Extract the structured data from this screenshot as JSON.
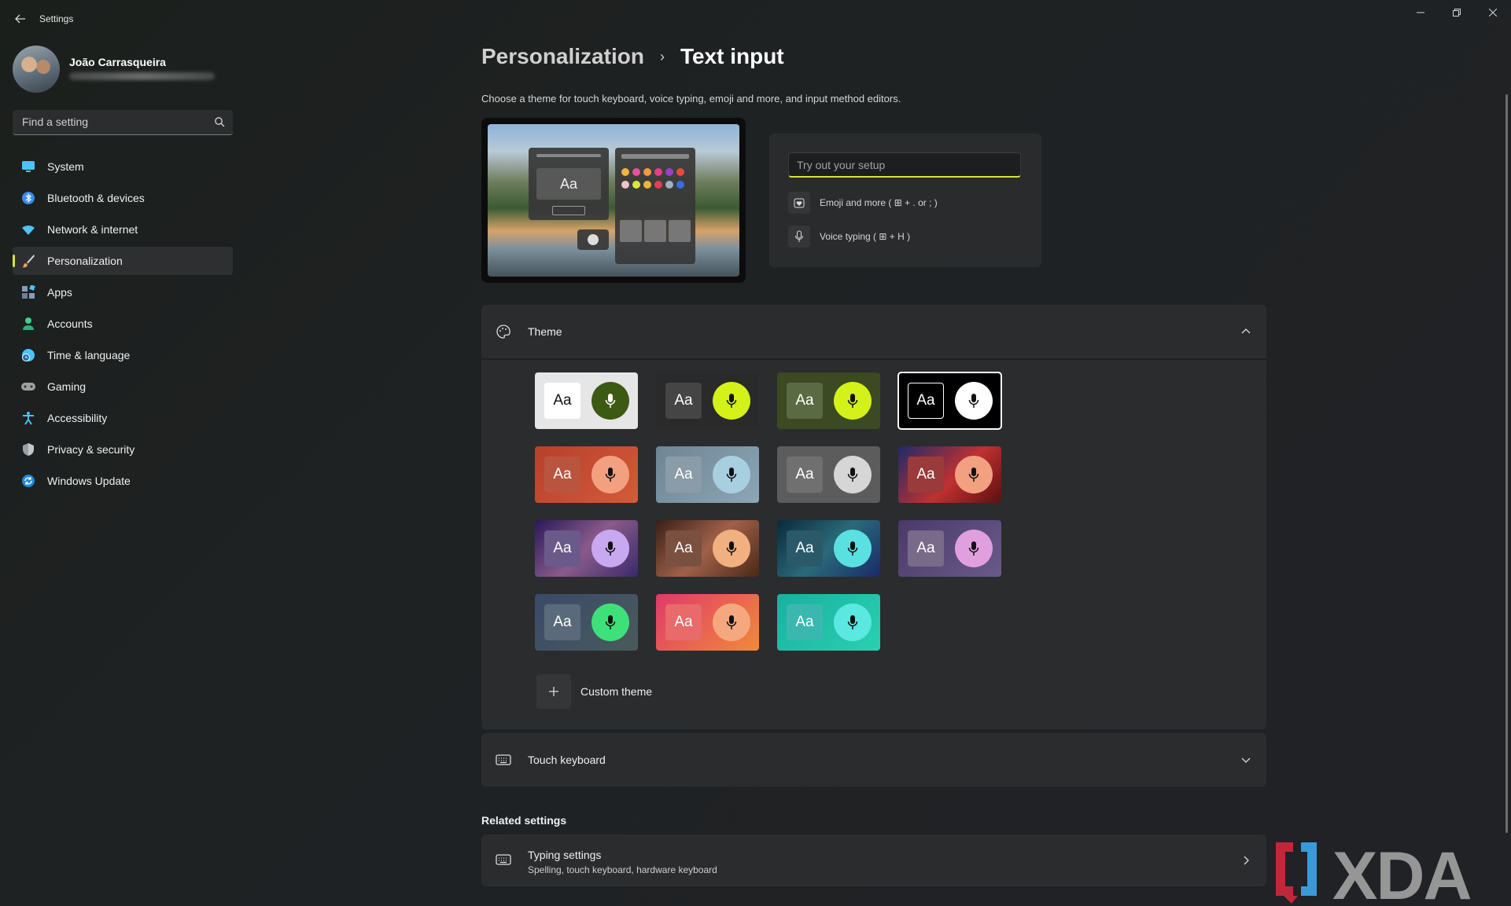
{
  "window": {
    "title": "Settings"
  },
  "user": {
    "name": "João Carrasqueira"
  },
  "search": {
    "placeholder": "Find a setting"
  },
  "sidebar": {
    "items": [
      {
        "label": "System",
        "icon": "monitor-icon",
        "color": "#4cc2ff"
      },
      {
        "label": "Bluetooth & devices",
        "icon": "bluetooth-icon",
        "color": "#3b8eea"
      },
      {
        "label": "Network & internet",
        "icon": "wifi-icon",
        "color": "#4cc2ff"
      },
      {
        "label": "Personalization",
        "icon": "brush-icon",
        "color": "#e8a060",
        "active": true
      },
      {
        "label": "Apps",
        "icon": "apps-icon",
        "color": "#8a9bb8"
      },
      {
        "label": "Accounts",
        "icon": "person-icon",
        "color": "#3fcf8e"
      },
      {
        "label": "Time & language",
        "icon": "globe-clock-icon",
        "color": "#4cc2ff"
      },
      {
        "label": "Gaming",
        "icon": "gamepad-icon",
        "color": "#a0a0a0"
      },
      {
        "label": "Accessibility",
        "icon": "accessibility-icon",
        "color": "#4cc2ff"
      },
      {
        "label": "Privacy & security",
        "icon": "shield-icon",
        "color": "#9aa0a6"
      },
      {
        "label": "Windows Update",
        "icon": "update-icon",
        "color": "#4cc2ff"
      }
    ]
  },
  "breadcrumb": {
    "parent": "Personalization",
    "separator": "›",
    "current": "Text input"
  },
  "description": "Choose a theme for touch keyboard, voice typing, emoji and more, and input method editors.",
  "try_panel": {
    "placeholder": "Try out your setup",
    "emoji_label": "Emoji and more ( ⊞ + . or ; )",
    "voice_label": "Voice typing ( ⊞ + H )"
  },
  "theme_card": {
    "title": "Theme",
    "aa_label": "Aa",
    "custom_label": "Custom theme",
    "tiles": [
      {
        "bg": "#e6e6e6",
        "aa_bg": "#ffffff",
        "aa_fg": "#111111",
        "mic_bg": "#3c5a14",
        "mic_fg": "#ffffff"
      },
      {
        "bg": "#2a2a2a",
        "aa_bg": "#454545",
        "aa_fg": "#ffffff",
        "mic_bg": "#d4f21a",
        "mic_fg": "#111111"
      },
      {
        "bg": "#3b4a22",
        "aa_bg": "#5a6a42",
        "aa_fg": "#ffffff",
        "mic_bg": "#d4f21a",
        "mic_fg": "#111111"
      },
      {
        "bg": "#000000",
        "aa_bg": "#000000",
        "aa_fg": "#ffffff",
        "mic_bg": "#ffffff",
        "mic_fg": "#111111",
        "selected": true
      },
      {
        "bg": "linear-gradient(135deg,#b7402a,#d45a3a)",
        "aa_bg": "#b9553e",
        "aa_fg": "#ffffff",
        "mic_bg": "#f2a080",
        "mic_fg": "#111111"
      },
      {
        "bg": "linear-gradient(135deg,#6d8594,#8ea6b4)",
        "aa_bg": "#8a9ca8",
        "aa_fg": "#ffffff",
        "mic_bg": "#a8cfe0",
        "mic_fg": "#111111"
      },
      {
        "bg": "#5c5c5c",
        "aa_bg": "#707070",
        "aa_fg": "#ffffff",
        "mic_bg": "#d6d6d6",
        "mic_fg": "#111111"
      },
      {
        "bg": "linear-gradient(135deg,#1e2a6a,#c03030 55%,#5a1010)",
        "aa_bg": "#9a3a3a",
        "aa_fg": "#ffffff",
        "mic_bg": "#f2a080",
        "mic_fg": "#111111"
      },
      {
        "bg": "linear-gradient(135deg,#2a1a5a,#8a5a8a 50%,#3a2a6a)",
        "aa_bg": "#6a5a8a",
        "aa_fg": "#ffffff",
        "mic_bg": "#c8a8f0",
        "mic_fg": "#111111"
      },
      {
        "bg": "linear-gradient(135deg,#3a2018,#a06048 50%,#4a2818)",
        "aa_bg": "#7a5040",
        "aa_fg": "#ffffff",
        "mic_bg": "#f0b080",
        "mic_fg": "#111111"
      },
      {
        "bg": "linear-gradient(135deg,#0a2a3a,#2a6a7a 50%,#1a2a6a)",
        "aa_bg": "#2a5a6a",
        "aa_fg": "#ffffff",
        "mic_bg": "#5ae0e0",
        "mic_fg": "#111111"
      },
      {
        "bg": "linear-gradient(135deg,#4a3a6a,#6a5a8a)",
        "aa_bg": "#7a6a8a",
        "aa_fg": "#ffffff",
        "mic_bg": "#e0a0e0",
        "mic_fg": "#111111"
      },
      {
        "bg": "linear-gradient(135deg,#3a4a6a,#4a5a5a)",
        "aa_bg": "#5a6a7a",
        "aa_fg": "#ffffff",
        "mic_bg": "#3ee07a",
        "mic_fg": "#111111"
      },
      {
        "bg": "linear-gradient(135deg,#e03a6a,#f08a3a)",
        "aa_bg": "#e86a6a",
        "aa_fg": "#ffffff",
        "mic_bg": "#f5a880",
        "mic_fg": "#111111"
      },
      {
        "bg": "linear-gradient(135deg,#1ab0a0,#2ad0b0)",
        "aa_bg": "#3ab8b0",
        "aa_fg": "#ffffff",
        "mic_bg": "#5ae8e0",
        "mic_fg": "#111111"
      }
    ]
  },
  "touch_card": {
    "title": "Touch keyboard"
  },
  "related": {
    "title": "Related settings",
    "typing_title": "Typing settings",
    "typing_sub": "Spelling, touch keyboard, hardware keyboard"
  },
  "watermark": {
    "text": "XDA"
  },
  "colors": {
    "accent": "#d6e33c"
  }
}
